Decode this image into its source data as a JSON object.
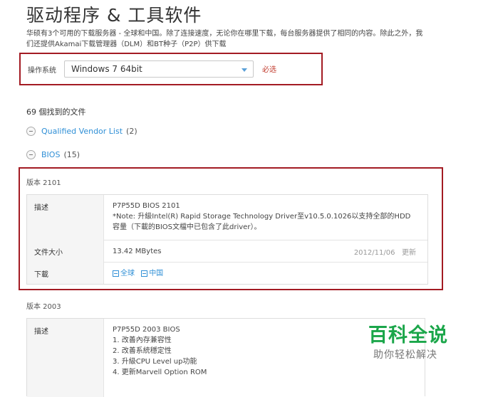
{
  "page": {
    "title": "驱动程序 & 工具软件",
    "intro": "华硕有3个可用的下载服务器 - 全球和中国。除了连接速度，无论你在哪里下载，每台服务器提供了相同的内容。除此之外，我们还提供Akamai下载管理器（DLM）和BT种子（P2P）供下载"
  },
  "os_select": {
    "label": "操作系统",
    "value": "Windows 7 64bit",
    "required": "必选"
  },
  "results": {
    "count_label": "69 個找到的文件"
  },
  "categories": [
    {
      "name": "Qualified Vendor List",
      "count": "(2)"
    },
    {
      "name": "BIOS",
      "count": "(15)"
    }
  ],
  "versions": [
    {
      "label": "版本 2101",
      "desc_header": "描述",
      "desc_lines": [
        "P7P55D BIOS 2101",
        "*Note: 升級Intel(R) Rapid Storage Technology Driver至v10.5.0.1026以支持全部的HDD",
        "容量（下載的BIOS文檔中已包含了此driver）。"
      ],
      "size_header": "文件大小",
      "size": "13.42 MBytes",
      "date": "2012/11/06",
      "updated": "更新",
      "download_header": "下載",
      "download_global": "全球",
      "download_china": "中国"
    },
    {
      "label": "版本 2003",
      "desc_header": "描述",
      "desc_lines": [
        "P7P55D 2003 BIOS",
        "1. 改善內存兼容性",
        "2. 改善系統穩定性",
        "3. 升級CPU Level up功能",
        "4. 更新Marvell Option ROM"
      ]
    }
  ],
  "watermark": {
    "title": "百科全说",
    "subtitle": "助你轻松解决"
  }
}
